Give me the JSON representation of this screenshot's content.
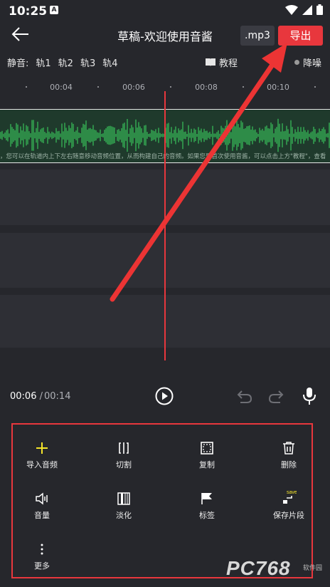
{
  "status": {
    "time": "10:25",
    "notif": "A"
  },
  "header": {
    "title": "草稿-欢迎使用音酱",
    "format": ".mp3",
    "export": "导出"
  },
  "mute": {
    "label": "静音:",
    "tracks": [
      "轨1",
      "轨2",
      "轨3",
      "轨4"
    ]
  },
  "tutorial": "教程",
  "denoise": "降噪",
  "ruler": {
    "ticks": [
      "00:04",
      "00:06",
      "00:08",
      "00:10"
    ]
  },
  "hint": "，您可以在轨道内上下左右随意移动音频位置，从而构建自己的音频。如果您是首次使用音酱，可以点击上方\"教程\"，查看",
  "transport": {
    "current": "00:06",
    "separator": "/",
    "total": "00:14"
  },
  "tools": [
    {
      "label": "导入音频",
      "icon": "plus-icon"
    },
    {
      "label": "切割",
      "icon": "cut-icon"
    },
    {
      "label": "复制",
      "icon": "copy-icon"
    },
    {
      "label": "删除",
      "icon": "trash-icon"
    },
    {
      "label": "音量",
      "icon": "volume-icon"
    },
    {
      "label": "淡化",
      "icon": "fade-icon"
    },
    {
      "label": "标签",
      "icon": "flag-icon"
    },
    {
      "label": "保存片段",
      "icon": "save-clip-icon"
    },
    {
      "label": "更多",
      "icon": "more-icon"
    }
  ],
  "save_badge": "save",
  "watermark": {
    "text": "PC768",
    "sub": "软件园"
  },
  "colors": {
    "accent": "#e8373d",
    "waveform": "#39c25a",
    "background": "#26272c"
  }
}
